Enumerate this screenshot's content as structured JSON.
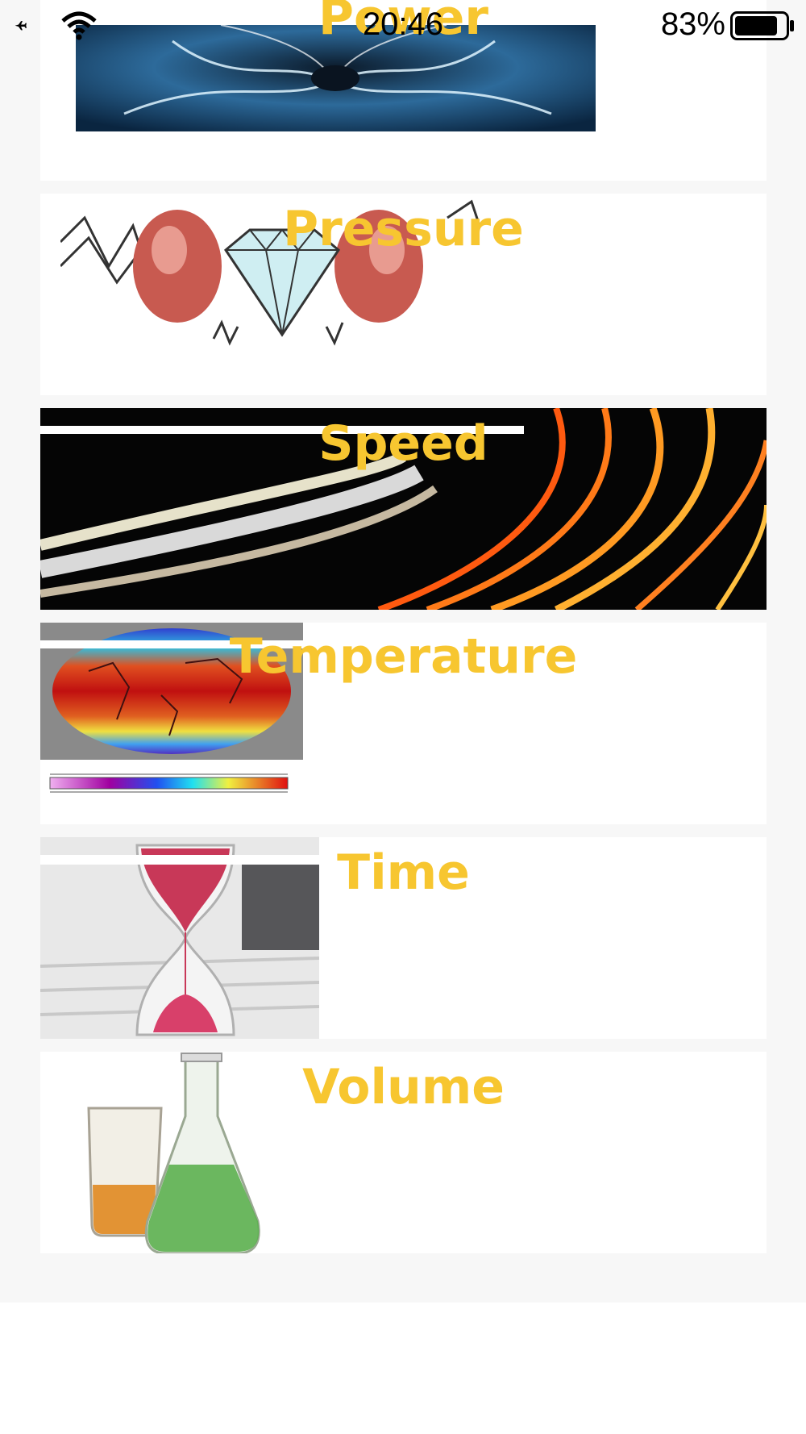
{
  "status_bar": {
    "time": "20:46",
    "battery_percent": "83%",
    "icons": [
      "airplane-mode-icon",
      "wifi-icon",
      "battery-icon"
    ]
  },
  "categories": [
    {
      "title": "Power",
      "image": "lightning-image"
    },
    {
      "title": "Pressure",
      "image": "diamond-vise-image"
    },
    {
      "title": "Speed",
      "image": "light-trails-image"
    },
    {
      "title": "Temperature",
      "image": "world-temperature-map-image"
    },
    {
      "title": "Time",
      "image": "hourglass-image"
    },
    {
      "title": "Volume",
      "image": "lab-glassware-image"
    }
  ],
  "colors": {
    "title_text": "#f7c630",
    "list_background": "#f7f7f7",
    "card_background": "#ffffff"
  }
}
